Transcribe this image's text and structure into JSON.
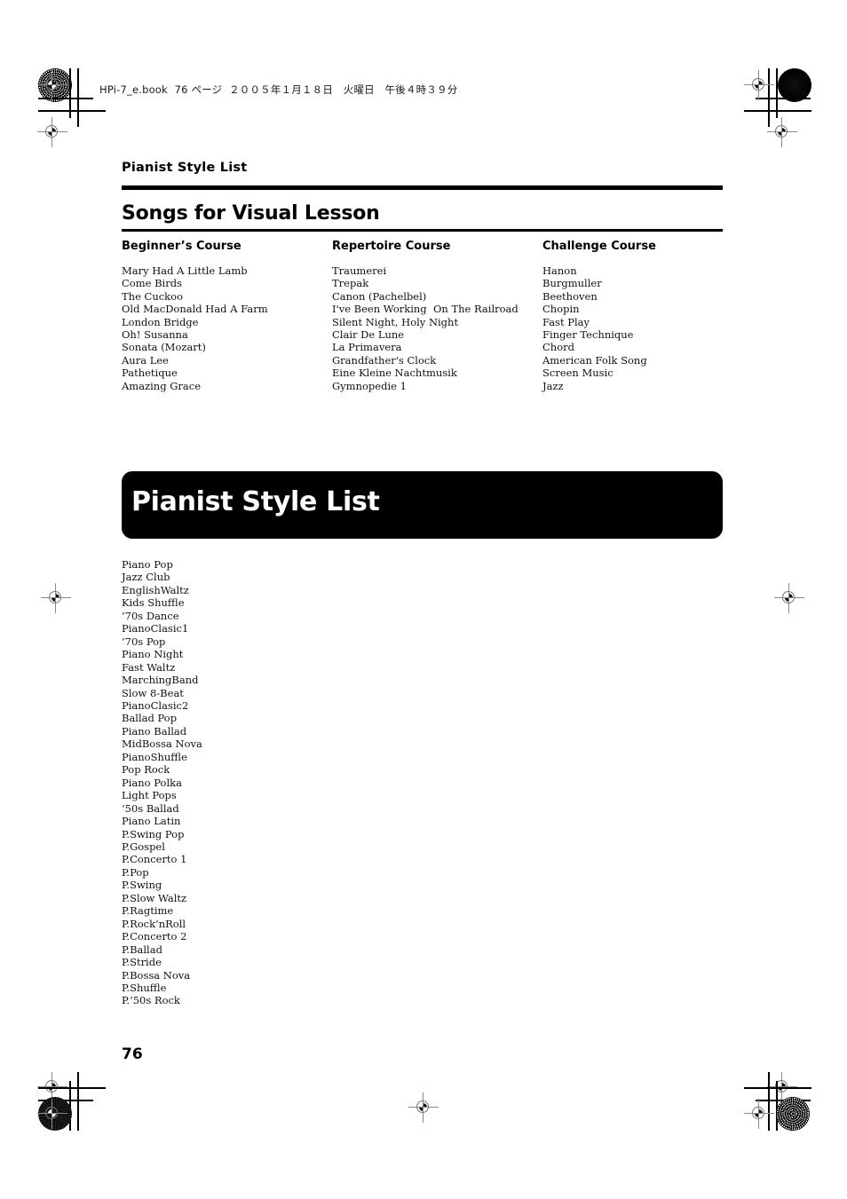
{
  "print_marks": {
    "book_info": "HPi-7_e.book  76 ページ  ２００５年１月１８日　火曜日　午後４時３９分"
  },
  "document": {
    "running_head": "Pianist Style List",
    "section_title": "Songs for Visual Lesson",
    "page_number": "76",
    "columns": [
      {
        "heading": "Beginner’s Course",
        "songs": [
          "Mary Had A Little Lamb",
          "Come Birds",
          "The Cuckoo",
          "Old MacDonald Had A Farm",
          "London Bridge",
          "Oh! Susanna",
          "Sonata (Mozart)",
          "Aura Lee",
          "Pathetique",
          "Amazing Grace"
        ]
      },
      {
        "heading": "Repertoire Course",
        "songs": [
          "Traumerei",
          "Trepak",
          "Canon (Pachelbel)",
          "I've Been Working  On The Railroad",
          "Silent Night, Holy Night",
          "Clair De Lune",
          "La Primavera",
          "Grandfather's Clock",
          "Eine Kleine Nachtmusik",
          "Gymnopedie 1"
        ]
      },
      {
        "heading": "Challenge Course",
        "songs": [
          "Hanon",
          "Burgmuller",
          "Beethoven",
          "Chopin",
          "Fast Play",
          "Finger Technique",
          "Chord",
          "American Folk Song",
          "Screen Music",
          "Jazz"
        ]
      }
    ],
    "banner": {
      "title": "Pianist Style List"
    },
    "styles": [
      "Piano Pop",
      "Jazz Club",
      "EnglishWaltz",
      "Kids Shuffle",
      "’70s Dance",
      "PianoClasic1",
      "’70s Pop",
      "Piano Night",
      "Fast Waltz",
      "MarchingBand",
      "Slow 8-Beat",
      "PianoClasic2",
      "Ballad Pop",
      "Piano Ballad",
      "MidBossa Nova",
      "PianoShuffle",
      "Pop Rock",
      "Piano Polka",
      "Light Pops",
      "’50s Ballad",
      "Piano Latin",
      "P.Swing Pop",
      "P.Gospel",
      "P.Concerto 1",
      "P.Pop",
      "P.Swing",
      "P.Slow Waltz",
      "P.Ragtime",
      "P.Rock’nRoll",
      "P.Concerto 2",
      "P.Ballad",
      "P.Stride",
      "P.Bossa Nova",
      "P.Shuffle",
      "P.’50s Rock"
    ]
  }
}
